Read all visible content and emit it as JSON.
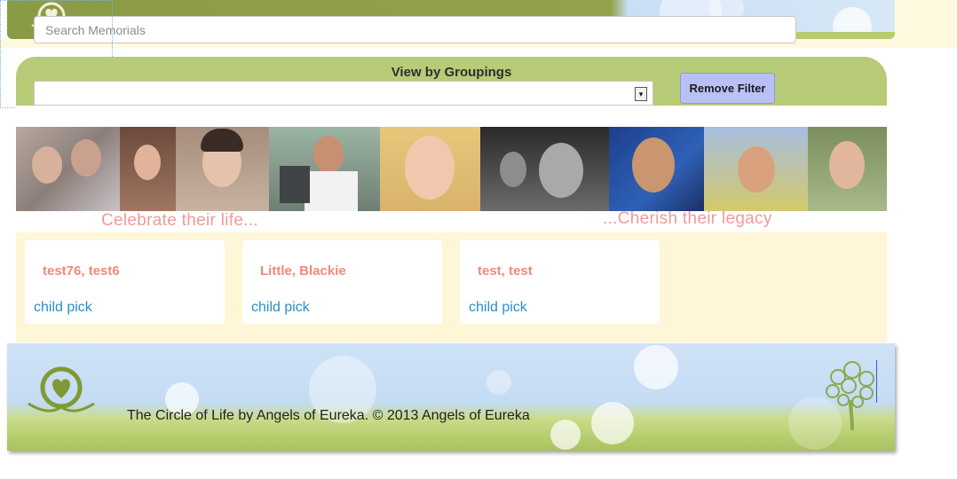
{
  "search": {
    "placeholder": "Search Memorials"
  },
  "groupings": {
    "title": "View by Groupings",
    "selected_value": "",
    "remove_filter_label": "Remove Filter"
  },
  "banner": {
    "left_tagline": "Celebrate their life...",
    "right_tagline": "...Cherish their legacy"
  },
  "memorials": [
    {
      "name": "test76, test6",
      "category": "child pick"
    },
    {
      "name": "Little, Blackie",
      "category": "child pick"
    },
    {
      "name": "test, test",
      "category": "child pick"
    }
  ],
  "footer": {
    "text": "The Circle of Life by Angels of Eureka. © 2013 Angels of Eureka"
  },
  "colors": {
    "header_green": "#8a9b45",
    "panel_green": "#b8cb77",
    "cream": "#fff6d8",
    "accent_pink": "#ef9b97",
    "link_blue": "#2a8fc6",
    "button_blue": "#b8c0f5"
  },
  "icons": {
    "header_logo": "heart-in-hands-icon",
    "footer_logo": "heart-in-hands-icon",
    "footer_tree": "swirl-tree-icon",
    "dropdown_arrow": "dropdown-arrow-icon"
  }
}
